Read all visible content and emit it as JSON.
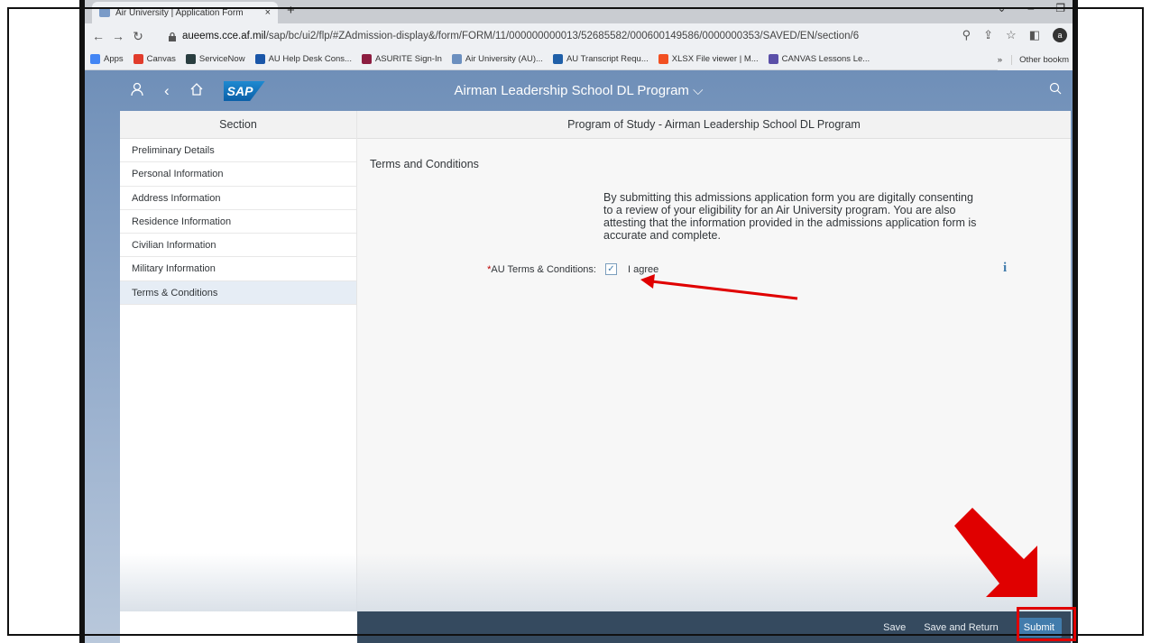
{
  "browser": {
    "tab_title": "Air University | Application Form",
    "tab_close": "×",
    "new_tab": "+",
    "url_host": "aueems.cce.af.mil",
    "url_path": "/sap/bc/ui2/flp/#ZAdmission-display&/form/FORM/11/000000000013/52685582/000600149586/0000000353/SAVED/EN/section/6",
    "profile_initial": "a"
  },
  "bookmarks": [
    {
      "label": "Apps",
      "color": "#4285f4"
    },
    {
      "label": "Canvas",
      "color": "#e13c2c"
    },
    {
      "label": "ServiceNow",
      "color": "#293e40"
    },
    {
      "label": "AU Help Desk Cons...",
      "color": "#1a56a8"
    },
    {
      "label": "ASURITE Sign-In",
      "color": "#8c1d40"
    },
    {
      "label": "Air University (AU)...",
      "color": "#6b8fbf"
    },
    {
      "label": "AU Transcript Requ...",
      "color": "#1f5fa8"
    },
    {
      "label": "XLSX File viewer | M...",
      "color": "#f25022"
    },
    {
      "label": "CANVAS Lessons Le...",
      "color": "#5a4fa8"
    }
  ],
  "bookmarks_overflow": "»",
  "bookmarks_other": "Other bookm",
  "shell": {
    "app_title": "Airman Leadership School DL Program",
    "logo_text": "SAP"
  },
  "sidebar": {
    "header": "Section",
    "items": [
      {
        "label": "Preliminary Details"
      },
      {
        "label": "Personal Information"
      },
      {
        "label": "Address Information"
      },
      {
        "label": "Residence Information"
      },
      {
        "label": "Civilian Information"
      },
      {
        "label": "Military Information"
      },
      {
        "label": "Terms & Conditions"
      }
    ]
  },
  "main": {
    "header": "Program of Study - Airman Leadership School DL Program",
    "section_title": "Terms and Conditions",
    "terms_text": "By submitting this admissions application form you are digitally consenting to a review of your eligibility for an Air University program. You are also attesting that the information provided in the admissions application form is accurate and complete.",
    "consent_required_mark": "*",
    "consent_label": "AU Terms & Conditions:",
    "consent_checked": true,
    "consent_value": "I agree",
    "info_icon_glyph": "i"
  },
  "footer": {
    "save": "Save",
    "save_return": "Save and Return",
    "submit": "Submit"
  },
  "colors": {
    "annotation_red": "#e00000",
    "footer_bg": "#354a5f",
    "submit_bg": "#427cac"
  }
}
